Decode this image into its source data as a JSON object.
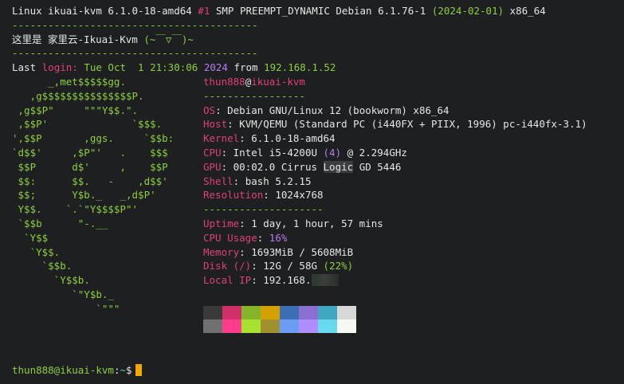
{
  "header": {
    "uname": "Linux ikuai-kvm 6.1.0-18-amd64 #1 SMP PREEMPT_DYNAMIC Debian 6.1.76-1 (2024-02-01) x86_64",
    "uname_pre": "Linux ikuai-kvm 6.1.0-18-amd64 ",
    "uname_hash": "#1",
    "uname_mid": " SMP PREEMPT_DYNAMIC Debian 6.1.76-1 ",
    "uname_date": "(2024-02-01)",
    "uname_post": " x86_64",
    "sep1": "-----------------------------------------",
    "motd_pre": "这里是 家里云-Ikuai-Kvm ",
    "motd_face": "(~￣▽￣)~",
    "sep2": "-----------------------------------------",
    "last_label": "Last ",
    "last_login": "login:",
    "last_date": " Tue Oct  1 21:30:06 ",
    "last_year": "2024",
    "last_from": " from ",
    "last_ip": "192.168.1.52"
  },
  "logo": [
    "      _,met$$$$$gg.",
    "   ,g$$$$$$$$$$$$$$$P.",
    " ,g$$P\"     \"\"\"Y$$.\".",
    " ,$$P'              `$$$.",
    "',$$P       ,ggs.     `$$b:",
    "`d$$'     ,$P\"'   .    $$$",
    " $$P      d$'     ,    $$P",
    " $$:      $$.   -    ,d$$'",
    " $$;      Y$b._   _,d$P'",
    " Y$$.    `.`\"Y$$$$P\"'",
    " `$$b      \"-.__",
    "  `Y$$",
    "   `Y$$.",
    "     `$$b.",
    "       `Y$$b.",
    "          `\"Y$b._",
    "              `\"\"\""
  ],
  "info": {
    "user": "thun888",
    "at": "@",
    "host": "ikuai-kvm",
    "underline": "-----------------",
    "os_label": "OS",
    "os_value": "Debian GNU/Linux 12 (bookworm) x86_64",
    "host_label": "Host",
    "host_value": "KVM/QEMU (Standard PC (i440FX + PIIX, 1996) pc-i440fx-3.1)",
    "kernel_label": "Kernel",
    "kernel_value": "6.1.0-18-amd64",
    "cpu_label": "CPU",
    "cpu_value_pre": "Intel i5-4200U ",
    "cpu_cores": "(4)",
    "cpu_value_post": " @ 2.294GHz",
    "gpu_label": "GPU",
    "gpu_value_pre": "00:02.0 Cirrus ",
    "gpu_value_hl": "Logic",
    "gpu_value_post": " GD 5446",
    "shell_label": "Shell",
    "shell_value": "bash 5.2.15",
    "resolution_label": "Resolution",
    "resolution_value": "1024x768",
    "underline2": "--------------------",
    "uptime_label": "Uptime",
    "uptime_value": "1 day, 1 hour, 57 mins",
    "cpu_usage_label": "CPU Usage",
    "cpu_usage_value": "16%",
    "memory_label": "Memory",
    "memory_value": "1693MiB / 5608MiB",
    "disk_label": "Disk (/)",
    "disk_value_pre": "12G / 58G ",
    "disk_pct": "(22%)",
    "localip_label": "Local IP",
    "localip_value": "192.168.",
    "sep": ": "
  },
  "palette": [
    "#3a3a3a",
    "#d0306a",
    "#86b52c",
    "#d4a100",
    "#3a6fb5",
    "#8a6fd0",
    "#3fa8c0",
    "#d8d8d8",
    "#707070",
    "#ff3d8b",
    "#a6e22e",
    "#a09030",
    "#6a9ef5",
    "#b18cff",
    "#66d9ef",
    "#f8f8f2"
  ],
  "prompt": {
    "user_host": "thun888@ikuai-kvm",
    "colon": ":",
    "path": "~",
    "dollar": "$"
  }
}
